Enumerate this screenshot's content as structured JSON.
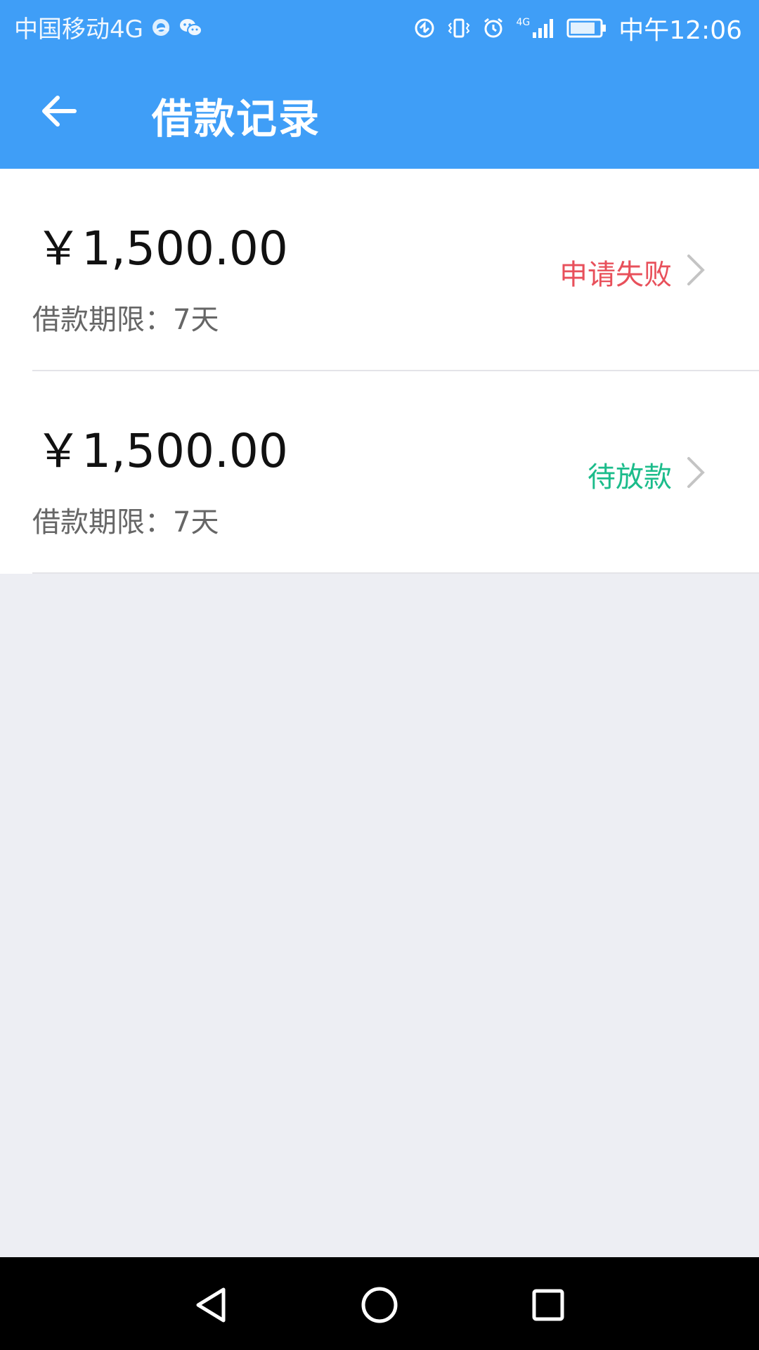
{
  "status_bar": {
    "carrier": "中国移动4G",
    "time": "中午12:06",
    "network_label": "4G",
    "icons_left": [
      "browser-icon",
      "wechat-icon"
    ],
    "icons_right": [
      "data-saver-icon",
      "vibrate-icon",
      "alarm-icon",
      "signal-icon",
      "battery-icon"
    ]
  },
  "app_bar": {
    "title": "借款记录",
    "back_icon": "arrow-left-icon"
  },
  "loans": [
    {
      "amount": "￥1,500.00",
      "term": "借款期限：7天",
      "status": "申请失败",
      "status_color": "#e8505b"
    },
    {
      "amount": "￥1,500.00",
      "term": "借款期限：7天",
      "status": "待放款",
      "status_color": "#1cbc8b"
    }
  ],
  "colors": {
    "primary": "#3f9ef7",
    "background": "#edeef3",
    "chevron": "#c4c4c4"
  },
  "nav_bar": {
    "buttons": [
      "back-triangle-icon",
      "home-circle-icon",
      "recents-square-icon"
    ]
  }
}
